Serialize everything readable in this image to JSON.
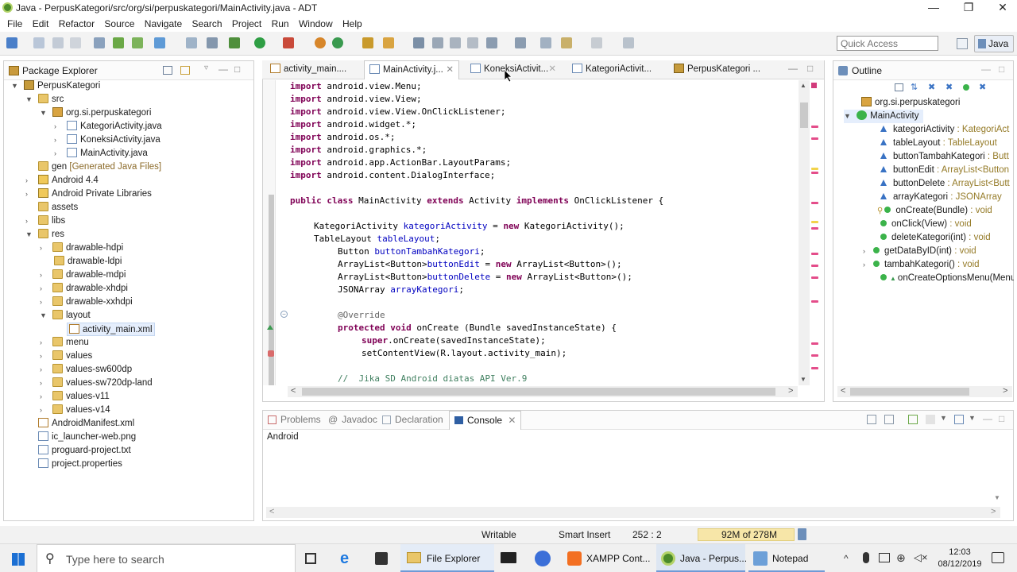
{
  "window": {
    "title": "Java - PerpusKategori/src/org/si/perpuskategori/MainActivity.java - ADT",
    "minimize": "—",
    "maximize": "❐",
    "close": "✕"
  },
  "menu": [
    "File",
    "Edit",
    "Refactor",
    "Source",
    "Navigate",
    "Search",
    "Project",
    "Run",
    "Window",
    "Help"
  ],
  "toolbar": {
    "quick_access_placeholder": "Quick Access",
    "perspective": "Java"
  },
  "package_explorer": {
    "title": "Package Explorer",
    "items": [
      {
        "label": "PerpusKategori"
      },
      {
        "label": "src"
      },
      {
        "label": "org.si.perpuskategori"
      },
      {
        "label": "KategoriActivity.java"
      },
      {
        "label": "KoneksiActivity.java"
      },
      {
        "label": "MainActivity.java"
      },
      {
        "label": "gen",
        "extra": "[Generated Java Files]"
      },
      {
        "label": "Android 4.4"
      },
      {
        "label": "Android Private Libraries"
      },
      {
        "label": "assets"
      },
      {
        "label": "libs"
      },
      {
        "label": "res"
      },
      {
        "label": "drawable-hdpi"
      },
      {
        "label": "drawable-ldpi"
      },
      {
        "label": "drawable-mdpi"
      },
      {
        "label": "drawable-xhdpi"
      },
      {
        "label": "drawable-xxhdpi"
      },
      {
        "label": "layout"
      },
      {
        "label": "activity_main.xml"
      },
      {
        "label": "menu"
      },
      {
        "label": "values"
      },
      {
        "label": "values-sw600dp"
      },
      {
        "label": "values-sw720dp-land"
      },
      {
        "label": "values-v11"
      },
      {
        "label": "values-v14"
      },
      {
        "label": "AndroidManifest.xml"
      },
      {
        "label": "ic_launcher-web.png"
      },
      {
        "label": "proguard-project.txt"
      },
      {
        "label": "project.properties"
      }
    ]
  },
  "editor": {
    "tabs": [
      "activity_main....",
      "MainActivity.j...",
      "KoneksiActivit...",
      "KategoriActivit...",
      "PerpusKategori ..."
    ],
    "imports": [
      "android.view.Menu;",
      "android.view.View;",
      "android.view.View.OnClickListener;",
      "android.widget.*;",
      "android.os.*;",
      "android.graphics.*;",
      "android.app.ActionBar.LayoutParams;",
      "android.content.DialogInterface;"
    ],
    "kw_import": "import",
    "class_line": {
      "kw1": "public class",
      "name": " MainActivity ",
      "kw2": "extends",
      "parent": " Activity ",
      "kw3": "implements",
      "iface": " OnClickListener {"
    },
    "field1": {
      "type": "KategoriActivity ",
      "name": "kategoriActivity",
      "rest": " = ",
      "kw": "new",
      "tail": " KategoriActivity();"
    },
    "field2": {
      "type": "TableLayout ",
      "name": "tableLayout",
      "tail": ";"
    },
    "field3": {
      "type": "Button ",
      "name": "buttonTambahKategori",
      "tail": ";"
    },
    "field4": {
      "type": "ArrayList<Button>",
      "name": "buttonEdit",
      "rest": " = ",
      "kw": "new",
      "tail": " ArrayList<Button>();"
    },
    "field5": {
      "type": "ArrayList<Button>",
      "name": "buttonDelete",
      "rest": " = ",
      "kw": "new",
      "tail": " ArrayList<Button>();"
    },
    "field6": {
      "type": "JSONArray ",
      "name": "arrayKategori",
      "tail": ";"
    },
    "override": "@Override",
    "method_line": {
      "kw": "protected void",
      "rest": " onCreate (Bundle savedInstanceState) {"
    },
    "super_line": {
      "kw": "super",
      "rest": ".onCreate(savedInstanceState);"
    },
    "setcv": "setContentView(R.layout.activity_main);",
    "comment": "//  Jika SD Android diatas API Ver.9"
  },
  "outline": {
    "title": "Outline",
    "package": "org.si.perpuskategori",
    "class": "MainActivity",
    "members": [
      {
        "name": "kategoriActivity",
        "type": " : KategoriAct"
      },
      {
        "name": "tableLayout",
        "type": " : TableLayout"
      },
      {
        "name": "buttonTambahKategori",
        "type": " : Butt"
      },
      {
        "name": "buttonEdit",
        "type": " : ArrayList<Button"
      },
      {
        "name": "buttonDelete",
        "type": " : ArrayList<Butt"
      },
      {
        "name": "arrayKategori",
        "type": " : JSONArray"
      },
      {
        "name": "onCreate(Bundle)",
        "type": " : void"
      },
      {
        "name": "onClick(View)",
        "type": " : void"
      },
      {
        "name": "deleteKategori(int)",
        "type": " : void"
      },
      {
        "name": "getDataByID(int)",
        "type": " : void"
      },
      {
        "name": "tambahKategori()",
        "type": " : void"
      },
      {
        "name": "onCreateOptionsMenu(Menu",
        "type": ""
      }
    ]
  },
  "console": {
    "tabs": [
      "Problems",
      "Javadoc",
      "Declaration",
      "Console"
    ],
    "content": "Android"
  },
  "status": {
    "writable": "Writable",
    "insert": "Smart Insert",
    "position": "252 : 2",
    "memory": "92M of 278M"
  },
  "taskbar": {
    "search_placeholder": "Type here to search",
    "file_explorer": "File Explorer",
    "xampp": "XAMPP Cont...",
    "java": "Java - Perpus...",
    "notepad": "Notepad",
    "time": "12:03",
    "date": "08/12/2019"
  },
  "colors": {
    "keyword": "#7f0055",
    "field": "#0000c0",
    "comment": "#3f7f5f",
    "accent": "#3a73c4"
  }
}
